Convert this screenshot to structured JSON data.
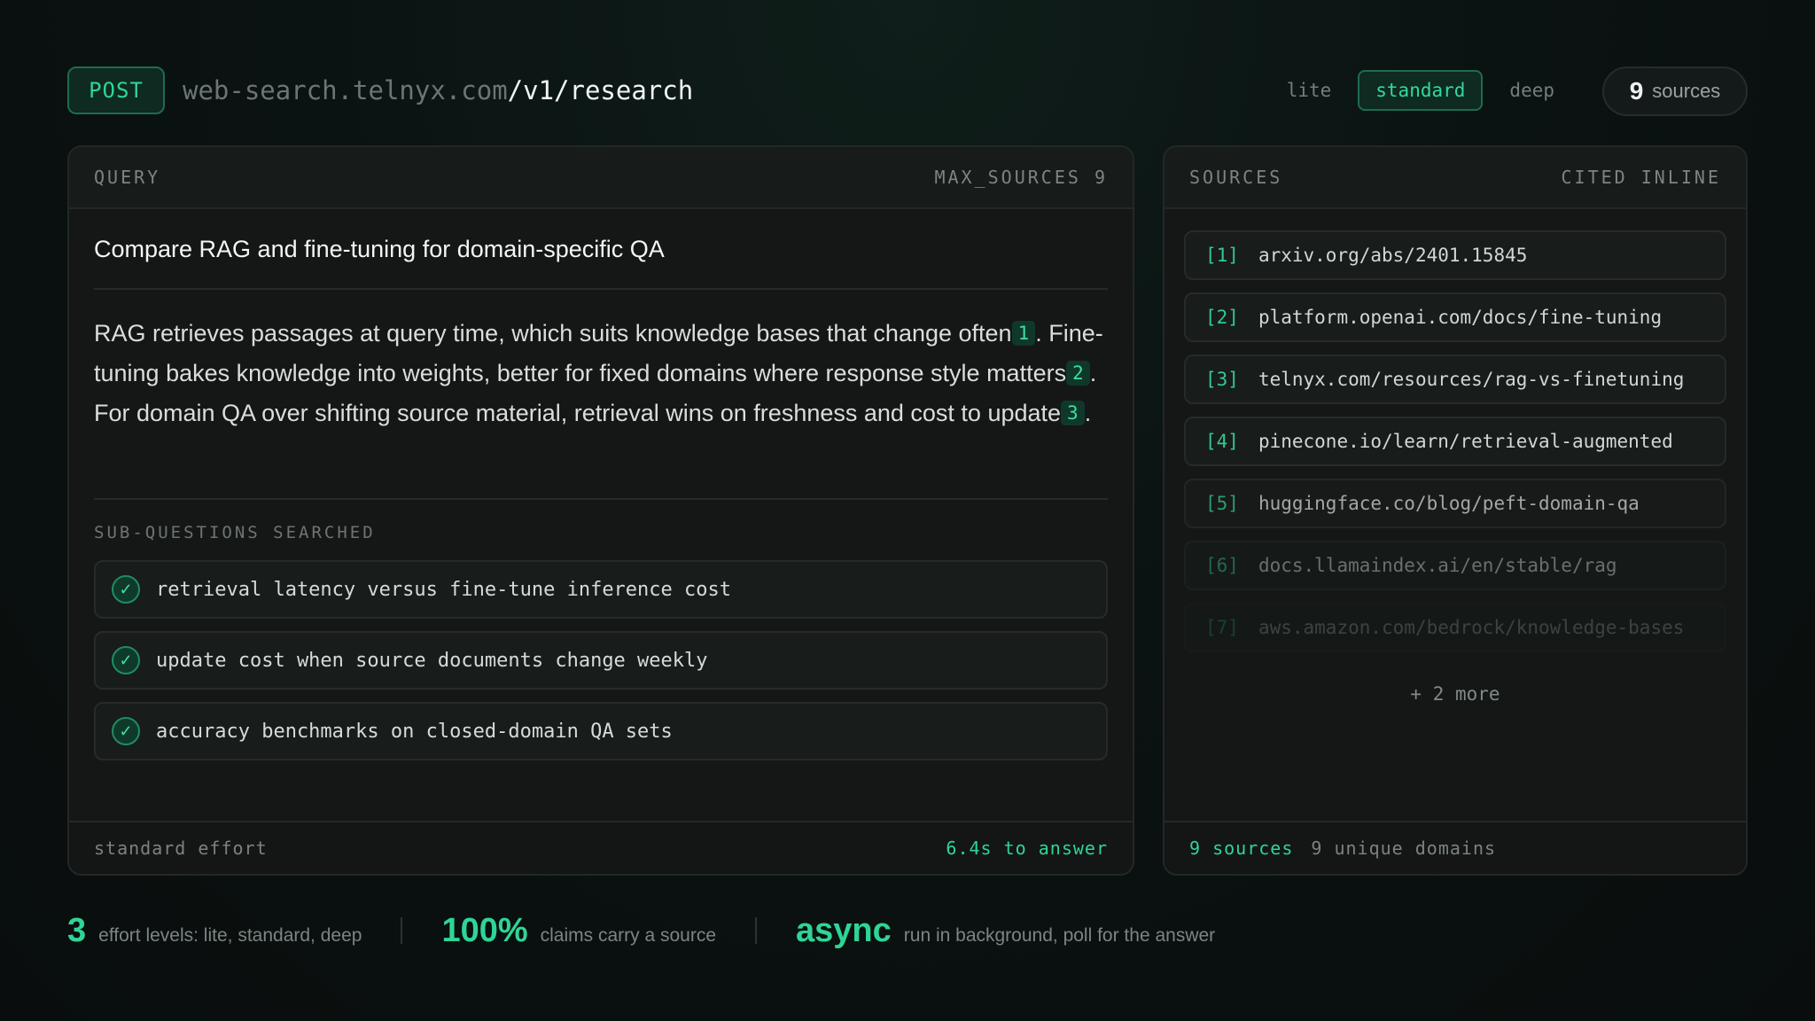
{
  "endpoint": {
    "method": "POST",
    "host": "web-search.telnyx.com",
    "path": "/v1/research"
  },
  "effort_levels": [
    {
      "label": "lite",
      "active": false
    },
    {
      "label": "standard",
      "active": true
    },
    {
      "label": "deep",
      "active": false
    }
  ],
  "source_count": {
    "number": "9",
    "label": "sources"
  },
  "query_panel": {
    "header_left": "QUERY",
    "header_right": "MAX_SOURCES 9",
    "question": "Compare RAG and fine-tuning for domain-specific QA",
    "answer": {
      "part1": "RAG retrieves passages at query time, which suits knowledge bases that change often",
      "cite1": "1",
      "part2": ". Fine-tuning bakes knowledge into weights, better for fixed domains where response style matters",
      "cite2": "2",
      "part3": ". For domain QA over shifting source material, retrieval wins on freshness and cost to update",
      "cite3": "3",
      "part4": "."
    },
    "sub_questions_heading": "SUB-QUESTIONS SEARCHED",
    "sub_questions": [
      "retrieval latency versus fine-tune inference cost",
      "update cost when source documents change weekly",
      "accuracy benchmarks on closed-domain QA sets"
    ],
    "footer_left": "standard effort",
    "footer_right": "6.4s to answer"
  },
  "sources_panel": {
    "header_left": "SOURCES",
    "header_right": "CITED INLINE",
    "items": [
      {
        "index": "[1]",
        "url": "arxiv.org/abs/2401.15845"
      },
      {
        "index": "[2]",
        "url": "platform.openai.com/docs/fine-tuning"
      },
      {
        "index": "[3]",
        "url": "telnyx.com/resources/rag-vs-finetuning"
      },
      {
        "index": "[4]",
        "url": "pinecone.io/learn/retrieval-augmented"
      },
      {
        "index": "[5]",
        "url": "huggingface.co/blog/peft-domain-qa"
      },
      {
        "index": "[6]",
        "url": "docs.llamaindex.ai/en/stable/rag"
      },
      {
        "index": "[7]",
        "url": "aws.amazon.com/bedrock/knowledge-bases"
      }
    ],
    "more": "+ 2 more",
    "footer_count": "9 sources",
    "footer_domains": "9 unique domains"
  },
  "stats": [
    {
      "value": "3",
      "text": "effort levels: lite, standard, deep"
    },
    {
      "value": "100%",
      "text": "claims carry a source"
    },
    {
      "value": "async",
      "text": "run in background, poll for the answer"
    }
  ],
  "colors": {
    "accent": "#2fd596",
    "background": "#0b1312",
    "panel": "#141716",
    "border": "#232827"
  },
  "icons": {
    "sub_question_status": "check-circle-icon"
  }
}
